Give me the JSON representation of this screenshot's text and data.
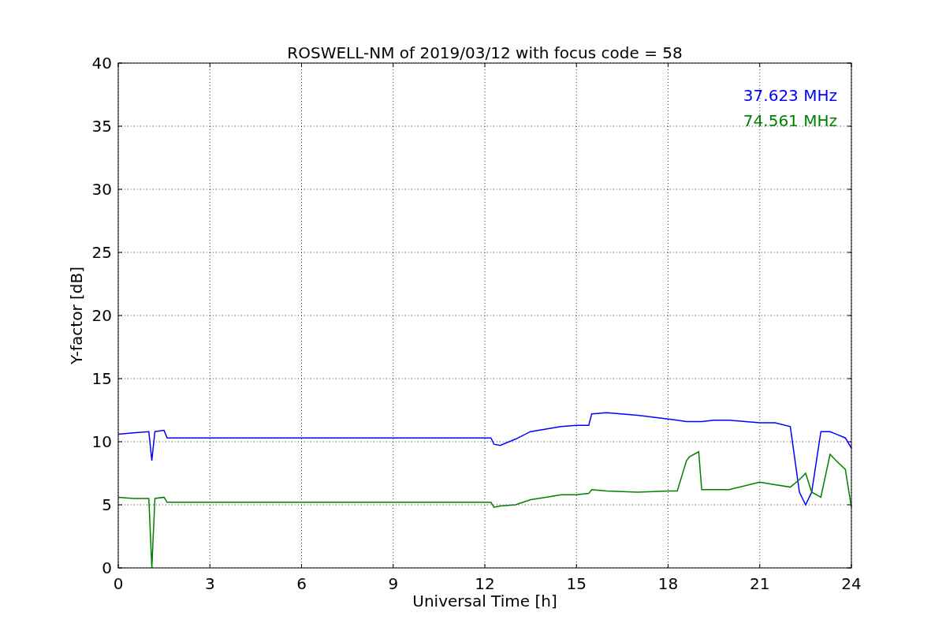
{
  "chart": {
    "chart_data": {
      "type": "line",
      "title": "ROSWELL-NM of 2019/03/12 with focus code = 58",
      "xlabel": "Universal Time [h]",
      "ylabel": "Y-factor [dB]",
      "x": [
        0,
        0.5,
        1,
        1.1,
        1.2,
        1.5,
        1.6,
        12.2,
        12.3,
        12.5,
        13,
        13.5,
        14,
        14.5,
        15,
        15.4,
        15.5,
        16,
        17,
        18,
        18.3,
        18.6,
        18.7,
        19,
        19.1,
        19.5,
        20,
        21,
        21.5,
        22,
        22.3,
        22.5,
        22.7,
        23,
        23.3,
        23.5,
        23.8,
        24
      ],
      "series": [
        {
          "name": "37.623 MHz",
          "color": "#0000ff",
          "values": [
            10.6,
            10.7,
            10.8,
            8.5,
            10.8,
            10.9,
            10.3,
            10.3,
            9.8,
            9.7,
            10.2,
            10.8,
            11.0,
            11.2,
            11.3,
            11.3,
            12.2,
            12.3,
            12.1,
            11.8,
            11.7,
            11.6,
            11.6,
            11.6,
            11.6,
            11.7,
            11.7,
            11.5,
            11.5,
            11.2,
            6,
            5,
            6,
            10.8,
            10.8,
            10.6,
            10.3,
            9.5
          ]
        },
        {
          "name": "74.561 MHz",
          "color": "#008000",
          "values": [
            5.6,
            5.5,
            5.5,
            0,
            5.5,
            5.6,
            5.2,
            5.2,
            4.8,
            4.9,
            5.0,
            5.4,
            5.6,
            5.8,
            5.8,
            5.9,
            6.2,
            6.1,
            6.0,
            6.1,
            6.1,
            8.5,
            8.8,
            9.2,
            6.2,
            6.2,
            6.2,
            6.8,
            6.6,
            6.4,
            7.0,
            7.5,
            6.0,
            5.6,
            9.0,
            8.5,
            7.8,
            4.8
          ]
        }
      ],
      "xlim": [
        0,
        24
      ],
      "ylim": [
        0,
        40
      ],
      "xticks": [
        0,
        3,
        6,
        9,
        12,
        15,
        18,
        21,
        24
      ],
      "yticks": [
        0,
        5,
        10,
        15,
        20,
        25,
        30,
        35,
        40
      ],
      "grid": true
    }
  }
}
